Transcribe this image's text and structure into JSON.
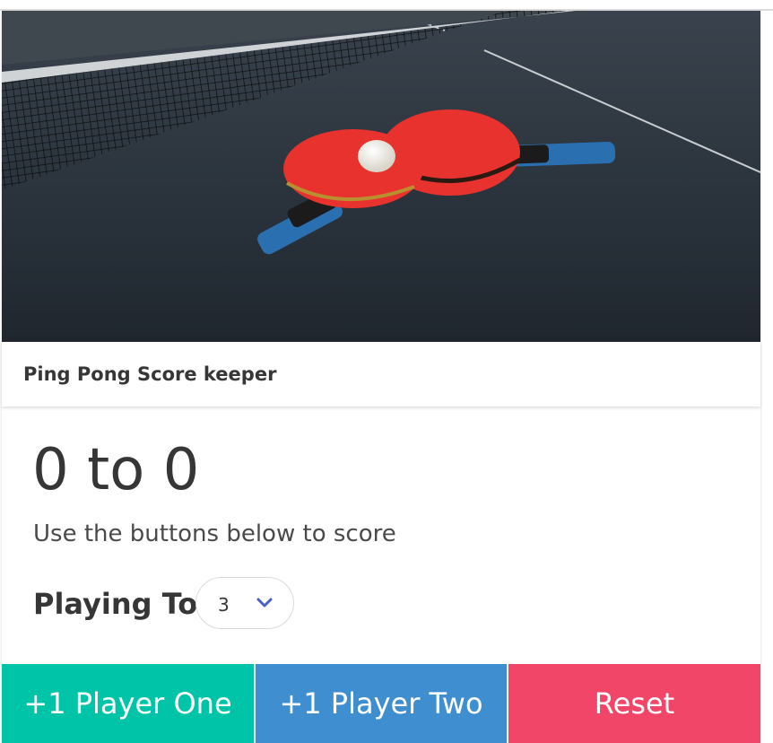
{
  "header": {
    "title": "Ping Pong Score keeper"
  },
  "image": {
    "subject": "ping pong paddles and ball on table",
    "colors": {
      "table": "#2b333c",
      "paddle": "#e8322d",
      "handle": "#2a6fb0",
      "ball": "#f2f0ea"
    }
  },
  "score": {
    "display": "0 to 0",
    "player_one": 0,
    "player_two": 0,
    "hint": "Use the buttons below to score"
  },
  "playing_to": {
    "label": "Playing To",
    "selected": "3"
  },
  "buttons": {
    "player_one": "+1 Player One",
    "player_two": "+1 Player Two",
    "reset": "Reset"
  },
  "colors": {
    "player_one": "#00c4a7",
    "player_two": "#3e8ed0",
    "reset": "#f14668"
  }
}
